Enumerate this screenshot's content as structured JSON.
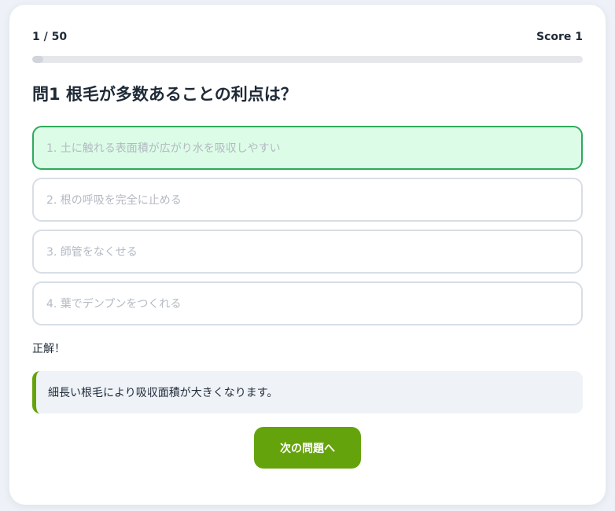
{
  "quiz": {
    "progress_text": "1 / 50",
    "score_text": "Score 1",
    "progress_fraction": 0.02,
    "question": "問1 根毛が多数あることの利点は？",
    "options": [
      {
        "label": "1. 土に触れる表面積が広がり水を吸収しやすい",
        "state": "correct"
      },
      {
        "label": "2. 根の呼吸を完全に止める",
        "state": "default"
      },
      {
        "label": "3. 師管をなくせる",
        "state": "default"
      },
      {
        "label": "4. 葉でデンプンをつくれる",
        "state": "default"
      }
    ],
    "result": "正解！",
    "explanation": "細長い根毛により吸収面積が大きくなります。",
    "next_button": "次の問題へ"
  },
  "colors": {
    "accent": "#65a30d",
    "correct_border": "#2faa5b",
    "correct_bg": "#dcfce7"
  }
}
